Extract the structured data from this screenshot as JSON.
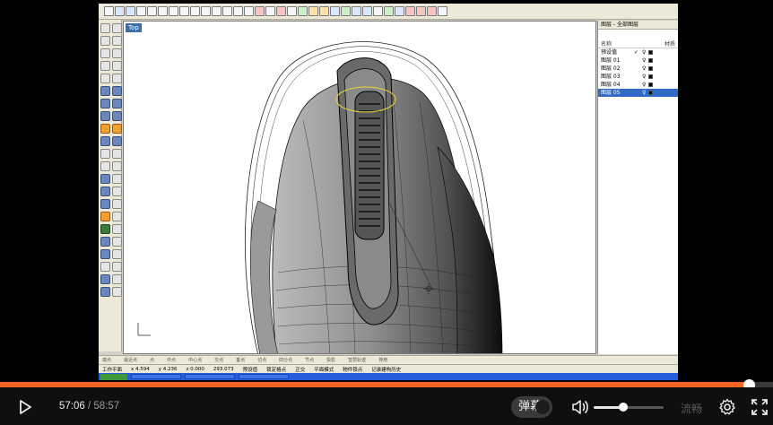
{
  "player": {
    "current_time": "57:06",
    "separator": " / ",
    "total_time": "58:57",
    "progress_fraction": 0.9687,
    "volume_fraction": 0.42,
    "danmaku_label": "弹幕",
    "quality_label": "流畅",
    "icons": [
      "play-icon",
      "volume-icon",
      "settings-gear-icon",
      "fullscreen-icon"
    ],
    "accent_color": "#f26522"
  },
  "rhino": {
    "viewport_label": "Top",
    "layers_panel": {
      "title": "图层 - 全部图层",
      "col_name": "名称",
      "col_material": "材质",
      "rows": [
        {
          "name": "预设值",
          "check": "✓",
          "selected": false
        },
        {
          "name": "图层 01",
          "check": "",
          "selected": false
        },
        {
          "name": "图层 02",
          "check": "",
          "selected": false
        },
        {
          "name": "图层 03",
          "check": "",
          "selected": false
        },
        {
          "name": "图层 04",
          "check": "",
          "selected": false
        },
        {
          "name": "图层 05",
          "check": "",
          "selected": true
        }
      ]
    },
    "status": {
      "plane": "工作平面",
      "x": "x 4.594",
      "y": "y 4.236",
      "z": "z 0.000",
      "extra": "293.073",
      "layer": "预设值",
      "grid_snap": "锁定格点",
      "ortho": "正交",
      "planar": "平面模式",
      "osnap": "物件锁点",
      "history": "记录建构历史"
    },
    "osnap_items": [
      "端点",
      "最近点",
      "点",
      "中点",
      "中心点",
      "交点",
      "垂点",
      "切点",
      "四分点",
      "节点",
      "投影",
      "智慧轨迹",
      "停用"
    ]
  }
}
